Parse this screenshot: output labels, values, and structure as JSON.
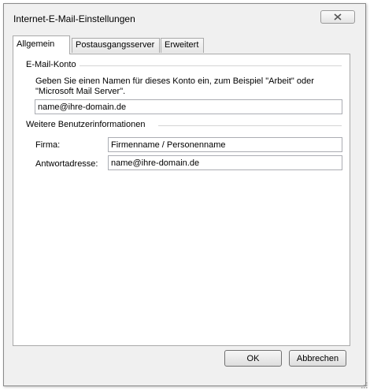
{
  "window": {
    "title": "Internet-E-Mail-Einstellungen",
    "close_icon": "close-icon"
  },
  "tabs": [
    {
      "label": "Allgemein",
      "active": true
    },
    {
      "label": "Postausgangsserver",
      "active": false
    },
    {
      "label": "Erweitert",
      "active": false
    }
  ],
  "account": {
    "section_label": "E-Mail-Konto",
    "hint": "Geben Sie einen Namen für dieses Konto ein, zum Beispiel \"Arbeit\" oder \"Microsoft Mail Server\".",
    "name_value": "name@ihre-domain.de"
  },
  "user_info": {
    "section_label": "Weitere Benutzerinformationen",
    "company_label": "Firma:",
    "company_value": "Firmenname / Personenname",
    "reply_label": "Antwortadresse:",
    "reply_value": "name@ihre-domain.de"
  },
  "buttons": {
    "ok_label": "OK",
    "cancel_label": "Abbrechen"
  }
}
